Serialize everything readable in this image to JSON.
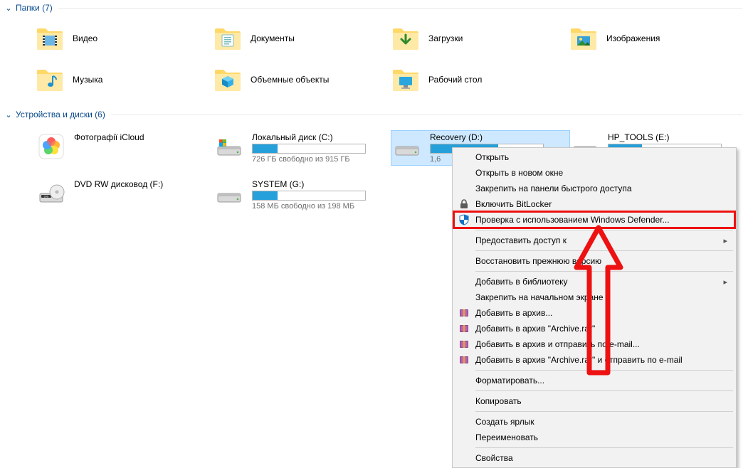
{
  "sections": {
    "folders": {
      "title": "Папки",
      "count": "(7)"
    },
    "drives": {
      "title": "Устройства и диски",
      "count": "(6)"
    }
  },
  "folders": {
    "video": "Видео",
    "documents": "Документы",
    "downloads": "Загрузки",
    "pictures": "Изображения",
    "music": "Музыка",
    "objects3d": "Объемные объекты",
    "desktop": "Рабочий стол"
  },
  "drives": {
    "icloud": {
      "label": "Фотографії iCloud"
    },
    "c": {
      "label": "Локальный диск (C:)",
      "free": "726 ГБ свободно из 915 ГБ",
      "fill": 22
    },
    "d": {
      "label": "Recovery (D:)",
      "free": "1,6",
      "fill": 60
    },
    "e": {
      "label": "HP_TOOLS (E:)",
      "free": "",
      "fill": 30
    },
    "dvd": {
      "label": "DVD RW дисковод (F:)"
    },
    "g": {
      "label": "SYSTEM (G:)",
      "free": "158 МБ свободно из 198 МБ",
      "fill": 22
    }
  },
  "ctx": {
    "open": "Открыть",
    "open_new": "Открыть в новом окне",
    "pin_quick": "Закрепить на панели быстрого доступа",
    "bitlocker": "Включить BitLocker",
    "defender": "Проверка с использованием Windows Defender...",
    "share": "Предоставить доступ к",
    "restore": "Восстановить прежнюю версию",
    "library": "Добавить в библиотеку",
    "pin_start": "Закрепить на начальном экране",
    "rar_add": "Добавить в архив...",
    "rar_archive": "Добавить в архив \"Archive.rar\"",
    "rar_email": "Добавить в архив и отправить по e-mail...",
    "rar_arch_em": "Добавить в архив \"Archive.rar\" и отправить по e-mail",
    "format": "Форматировать...",
    "copy": "Копировать",
    "shortcut": "Создать ярлык",
    "rename": "Переименовать",
    "properties": "Свойства"
  }
}
